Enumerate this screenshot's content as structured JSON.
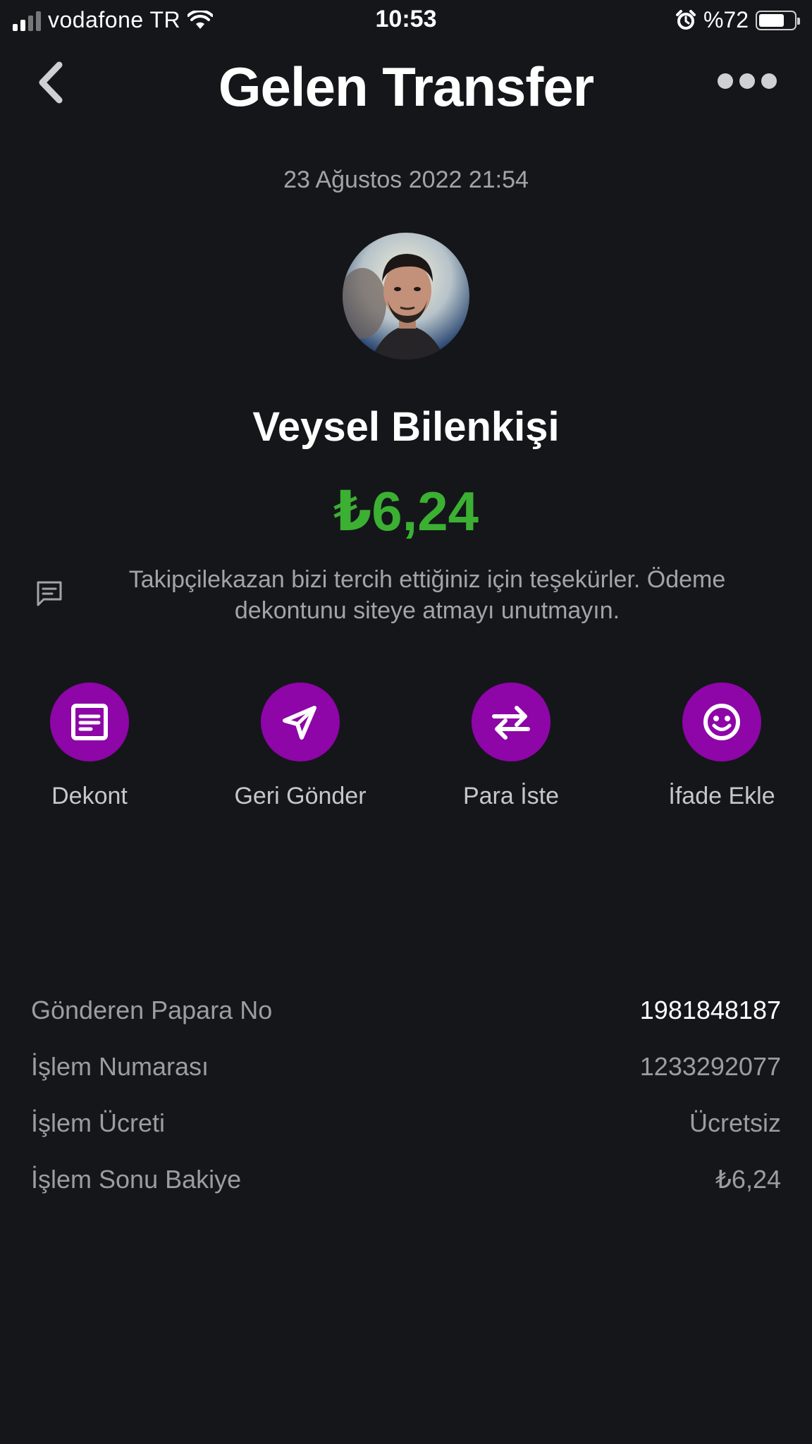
{
  "status_bar": {
    "carrier": "vodafone TR",
    "time": "10:53",
    "battery_percent": "%72",
    "battery_level": 0.72,
    "icons": [
      "signal-icon",
      "wifi-icon",
      "alarm-icon",
      "battery-icon"
    ]
  },
  "header": {
    "title": "Gelen Transfer",
    "back_icon": "chevron-left-icon",
    "more_icon": "more-dots-icon"
  },
  "transfer": {
    "date": "23 Ağustos 2022 21:54",
    "sender_name": "Veysel Bilenkişi",
    "amount": "₺6,24",
    "amount_color": "#3bb032",
    "message": "Takipçilekazan bizi tercih ettiğiniz için teşekürler. Ödeme dekontunu siteye atmayı unutmayın."
  },
  "actions": [
    {
      "label": "Dekont",
      "icon": "receipt-icon"
    },
    {
      "label": "Geri Gönder",
      "icon": "send-icon"
    },
    {
      "label": "Para İste",
      "icon": "swap-arrows-icon"
    },
    {
      "label": "İfade Ekle",
      "icon": "smiley-icon"
    }
  ],
  "accent_color": "#8e05a8",
  "details": [
    {
      "label": "Gönderen Papara No",
      "value": "1981848187"
    },
    {
      "label": "İşlem Numarası",
      "value": "1233292077"
    },
    {
      "label": "İşlem Ücreti",
      "value": "Ücretsiz"
    },
    {
      "label": "İşlem Sonu Bakiye",
      "value": "₺6,24"
    }
  ]
}
